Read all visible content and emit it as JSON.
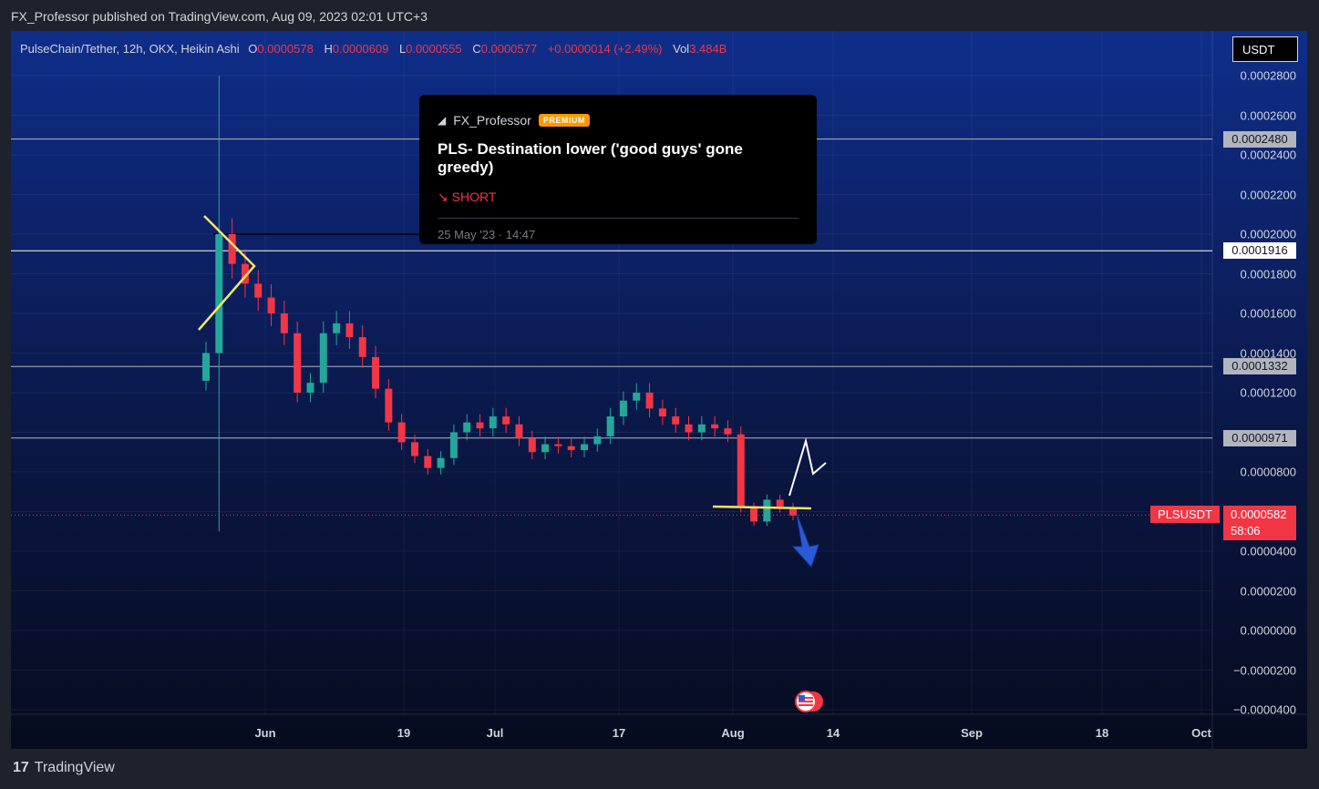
{
  "header": {
    "published": "FX_Professor published on TradingView.com, Aug 09, 2023 02:01 UTC+3"
  },
  "legend": {
    "symbol": "PulseChain/Tether, 12h, OKX, Heikin Ashi",
    "o_label": "O",
    "o_value": "0.0000578",
    "h_label": "H",
    "h_value": "0.0000609",
    "l_label": "L",
    "l_value": "0.0000555",
    "c_label": "C",
    "c_value": "0.0000577",
    "change": "+0.0000014 (+2.49%)",
    "vol_label": "Vol",
    "vol_value": "3.484B"
  },
  "currency_button": "USDT",
  "idea": {
    "author": "FX_Professor",
    "badge": "PREMIUM",
    "title": "PLS- Destination lower ('good guys' gone greedy)",
    "direction": "↘ SHORT",
    "date": "25 May '23 · 14:47"
  },
  "price_tag": {
    "symbol": "PLSUSDT",
    "price": "0.0000582",
    "countdown": "58:06"
  },
  "footer": {
    "brand": "TradingView",
    "logo": "17"
  },
  "colors": {
    "up": "#26a69a",
    "down": "#f23645",
    "accent": "#f23645",
    "drawing_yellow": "#f5e663",
    "arrow_blue": "#2a5bd7"
  },
  "chart_data": {
    "type": "candlestick",
    "title": "PulseChain/Tether, 12h, OKX, Heikin Ashi",
    "ylim": [
      -4e-05,
      0.00028
    ],
    "y_ticks": [
      "0.0002800",
      "0.0002600",
      "0.0002400",
      "0.0002200",
      "0.0002000",
      "0.0001800",
      "0.0001600",
      "0.0001400",
      "0.0001200",
      "0.0000800",
      "0.0000400",
      "0.0000200",
      "0.0000000",
      "−0.0000200",
      "−0.0000400"
    ],
    "x_ticks": [
      "Jun",
      "19",
      "Jul",
      "17",
      "Aug",
      "14",
      "Sep",
      "18",
      "Oct"
    ],
    "horizontal_levels": [
      {
        "value": 0.000248,
        "label": "0.0002480",
        "style": "gray"
      },
      {
        "value": 0.0001916,
        "label": "0.0001916",
        "style": "white"
      },
      {
        "value": 0.0001332,
        "label": "0.0001332",
        "style": "gray"
      },
      {
        "value": 9.71e-05,
        "label": "0.0000971",
        "style": "gray"
      }
    ],
    "current_price": 5.82e-05,
    "close_series": [
      0.00014,
      0.0002,
      0.000185,
      0.000175,
      0.000168,
      0.00016,
      0.00015,
      0.00012,
      0.000125,
      0.00015,
      0.000155,
      0.000148,
      0.000138,
      0.000122,
      0.000105,
      9.5e-05,
      8.8e-05,
      8.2e-05,
      8.7e-05,
      0.0001,
      0.000105,
      0.000102,
      0.000108,
      0.000104,
      9.7e-05,
      9e-05,
      9.4e-05,
      9.3e-05,
      9.1e-05,
      9.4e-05,
      9.8e-05,
      0.000108,
      0.000116,
      0.00012,
      0.000112,
      0.000108,
      0.000104,
      0.0001,
      0.000104,
      0.000102,
      9.9e-05,
      6.2e-05,
      5.5e-05,
      6.6e-05,
      6.2e-05,
      5.8e-05
    ]
  }
}
